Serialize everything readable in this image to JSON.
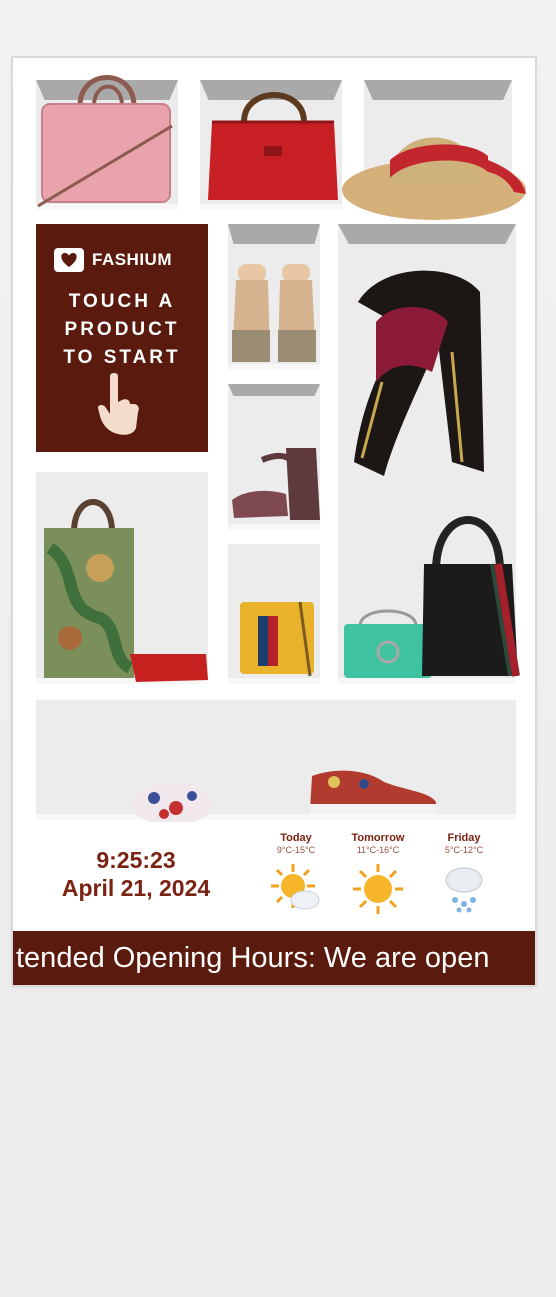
{
  "brand": {
    "name": "FASHIUM"
  },
  "promo": {
    "cta": "TOUCH A\nPRODUCT\nTO START"
  },
  "clock": {
    "time": "9:25:23",
    "date": "April 21, 2024"
  },
  "weather": [
    {
      "day": "Today",
      "temp": "9°C-15°C",
      "icon": "partly-sunny-icon"
    },
    {
      "day": "Tomorrow",
      "temp": "11°C-16°C",
      "icon": "sunny-icon"
    },
    {
      "day": "Friday",
      "temp": "5°C-12°C",
      "icon": "snow-cloud-icon"
    }
  ],
  "ticker": {
    "text": "tended Opening Hours: We are open"
  },
  "colors": {
    "accent": "#5a1a0d",
    "text_accent": "#7a2312"
  }
}
